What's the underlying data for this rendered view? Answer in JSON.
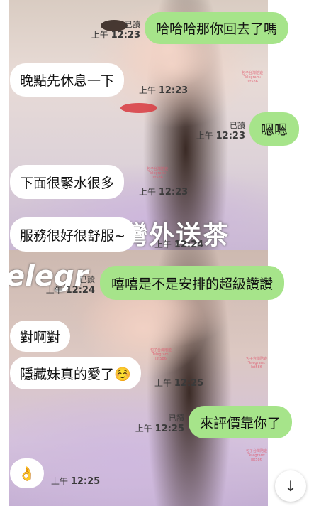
{
  "messages": [
    {
      "side": "me",
      "text": "哈哈哈那你回去了嗎",
      "read": "已讀",
      "ampm": "上午",
      "time": "12:23"
    },
    {
      "side": "them",
      "text": "晚點先休息一下",
      "ampm": "上午",
      "time": "12:23"
    },
    {
      "side": "me",
      "text": "嗯嗯",
      "read": "已讀",
      "ampm": "上午",
      "time": "12:23"
    },
    {
      "side": "them",
      "text": "下面很緊水很多",
      "ampm": "上午",
      "time": "12:23"
    },
    {
      "side": "them",
      "text": "服務很好很舒服~",
      "ampm": "上午",
      "time": "12:24"
    },
    {
      "side": "me",
      "text": "嘻嘻是不是安排的超級讚讚",
      "read": "已讀",
      "ampm": "上午",
      "time": "12:24"
    },
    {
      "side": "them",
      "text": "對啊對",
      "ampm": "",
      "time": ""
    },
    {
      "side": "them",
      "text": "隱藏妹真的愛了☺️",
      "ampm": "上午",
      "time": "12:25"
    },
    {
      "side": "me",
      "text": "來評價靠你了",
      "read": "已讀",
      "ampm": "上午",
      "time": "12:25"
    },
    {
      "side": "them",
      "text": "👌",
      "ampm": "上午",
      "time": "12:25"
    }
  ],
  "overlay": {
    "big_text": "灣外送茶",
    "script_text": "elegr"
  },
  "watermark": {
    "line1": "包子台灣陪遊",
    "line2": "Telegram: lxt586"
  },
  "scroll_button": {
    "icon": "arrow-down-icon",
    "glyph": "↓"
  },
  "colors": {
    "my_bubble": "#a6e48a",
    "their_bubble": "#ffffff"
  }
}
